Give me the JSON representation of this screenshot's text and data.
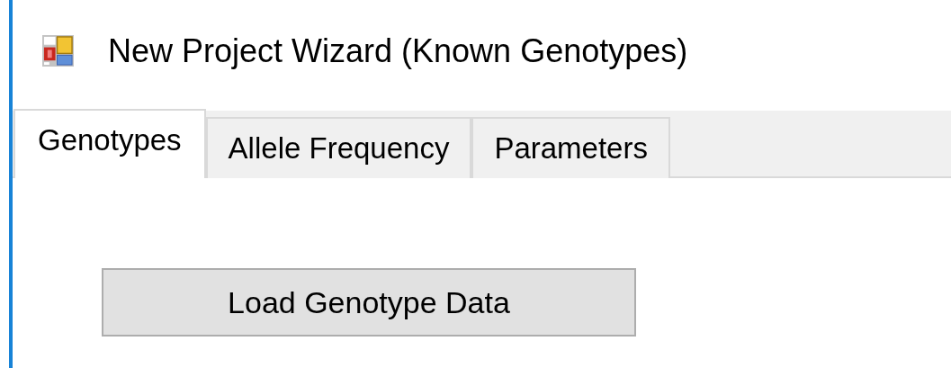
{
  "window": {
    "title": "New Project Wizard (Known Genotypes)"
  },
  "tabs": [
    {
      "label": "Genotypes",
      "selected": true
    },
    {
      "label": "Allele Frequency",
      "selected": false
    },
    {
      "label": "Parameters",
      "selected": false
    }
  ],
  "buttons": [
    "Load Genotype Data"
  ]
}
